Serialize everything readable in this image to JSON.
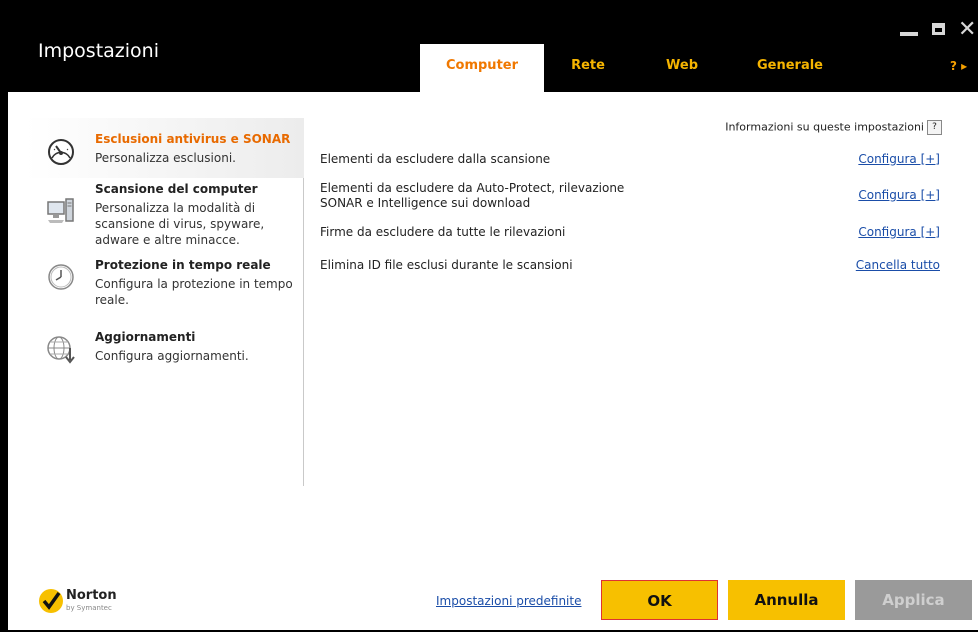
{
  "window": {
    "title": "Impostazioni",
    "help_label": "? ▸"
  },
  "tabs": [
    {
      "label": "Computer",
      "active": true
    },
    {
      "label": "Rete",
      "active": false
    },
    {
      "label": "Web",
      "active": false
    },
    {
      "label": "Generale",
      "active": false
    }
  ],
  "sidebar": {
    "items": [
      {
        "title": "Esclusioni antivirus e SONAR",
        "desc": "Personalizza esclusioni.",
        "icon": "gauge-icon",
        "selected": true
      },
      {
        "title": "Scansione del computer",
        "desc": "Personalizza la modalità di scansione di virus, spyware, adware e altre minacce.",
        "icon": "computer-icon",
        "selected": false
      },
      {
        "title": "Protezione in tempo reale",
        "desc": "Configura la protezione in tempo reale.",
        "icon": "clock-icon",
        "selected": false
      },
      {
        "title": "Aggiornamenti",
        "desc": "Configura aggiornamenti.",
        "icon": "globe-download-icon",
        "selected": false
      }
    ]
  },
  "main": {
    "info_label": "Informazioni su queste impostazioni",
    "info_icon": "?",
    "settings": [
      {
        "label": "Elementi da escludere dalla scansione",
        "link": "Configura [+]"
      },
      {
        "label": "Elementi da escludere da Auto-Protect, rilevazione SONAR e Intelligence sui download",
        "link": "Configura [+]"
      },
      {
        "label": "Firme da escludere da tutte le rilevazioni",
        "link": "Configura [+]"
      },
      {
        "label": "Elimina ID file esclusi durante le scansioni",
        "link": "Cancella tutto"
      }
    ]
  },
  "footer": {
    "defaults_link": "Impostazioni predefinite",
    "ok_label": "OK",
    "cancel_label": "Annulla",
    "apply_label": "Applica",
    "logo_text": "Norton",
    "logo_sub": "by Symantec"
  },
  "colors": {
    "accent_orange": "#f07800",
    "button_yellow": "#f7c000",
    "link_blue": "#1a4da8"
  }
}
